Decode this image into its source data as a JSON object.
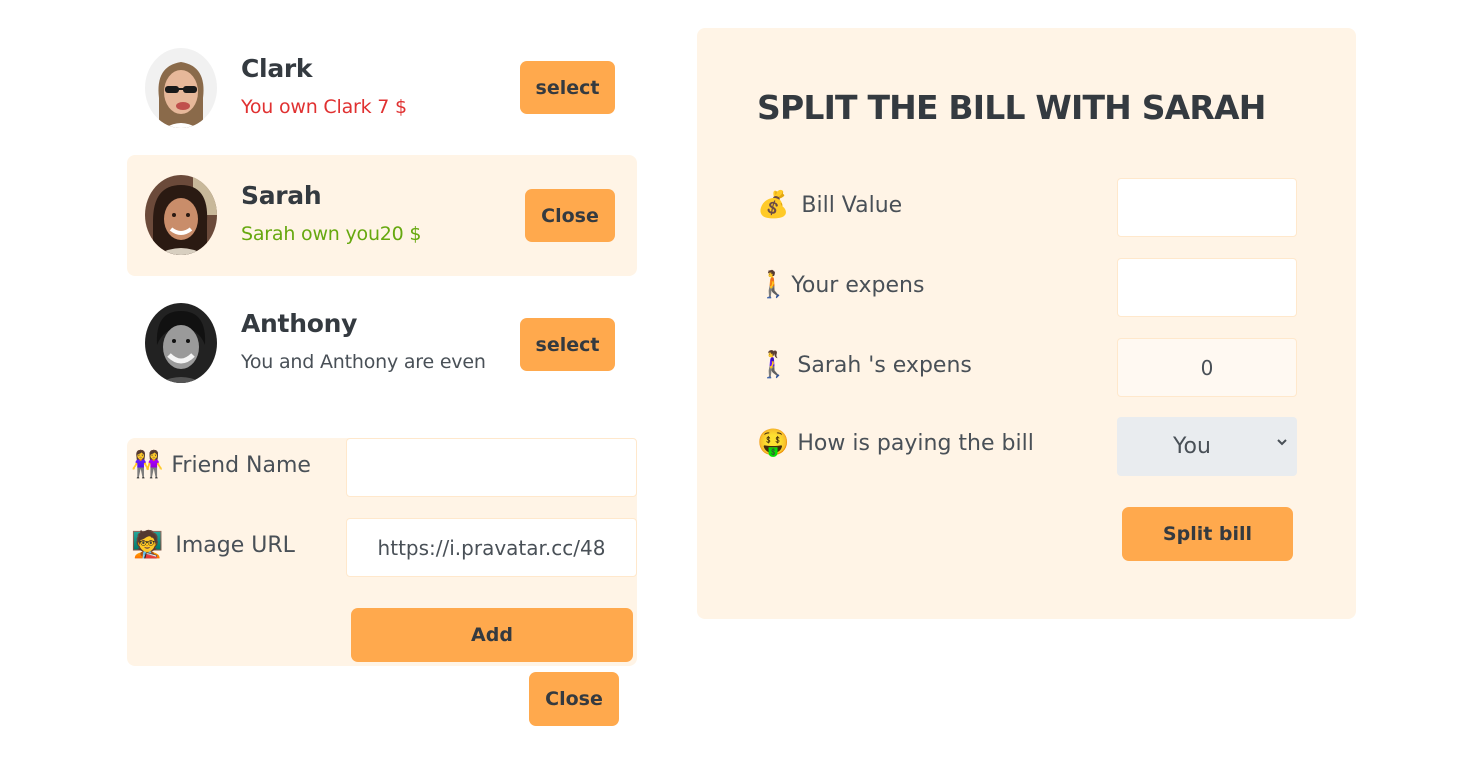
{
  "friends": [
    {
      "name": "Clark",
      "status": "You own Clark 7 $",
      "status_type": "red",
      "button": "select",
      "avatar_icon": "person-with-sunglasses-avatar"
    },
    {
      "name": "Sarah",
      "status": "Sarah own you20 $",
      "status_type": "green",
      "button": "Close",
      "avatar_icon": "woman-smiling-avatar"
    },
    {
      "name": "Anthony",
      "status": "You and Anthony are even",
      "status_type": "neutral",
      "button": "select",
      "avatar_icon": "man-smiling-avatar"
    }
  ],
  "add_form": {
    "friend_name_label": "Friend Name",
    "friend_name_icon": "two-people-emoji",
    "friend_name_value": "",
    "image_url_label": "Image URL",
    "image_url_icon": "person-at-computer-emoji",
    "image_url_value": "https://i.pravatar.cc/48",
    "add_button": "Add"
  },
  "close_form_button": "Close",
  "split": {
    "title": "SPLIT THE BILL WITH SARAH",
    "bill_value_label": "Bill Value",
    "bill_value_icon": "money-bag-emoji",
    "bill_value": "",
    "your_expense_label": "Your expens",
    "your_expense_icon": "person-walking-emoji",
    "your_expense_value": "",
    "friend_expense_label": "Sarah 's expens",
    "friend_expense_icon": "woman-walking-emoji",
    "friend_expense_value": "0",
    "payer_label": "How is paying the bill",
    "payer_icon": "money-mouth-face-emoji",
    "payer_value": "You",
    "split_button": "Split bill"
  },
  "colors": {
    "accent": "#ffa94d",
    "panel_bg": "#fff4e6",
    "text": "#495057",
    "heading": "#343a40",
    "red": "#e03131",
    "green": "#66a80f"
  }
}
